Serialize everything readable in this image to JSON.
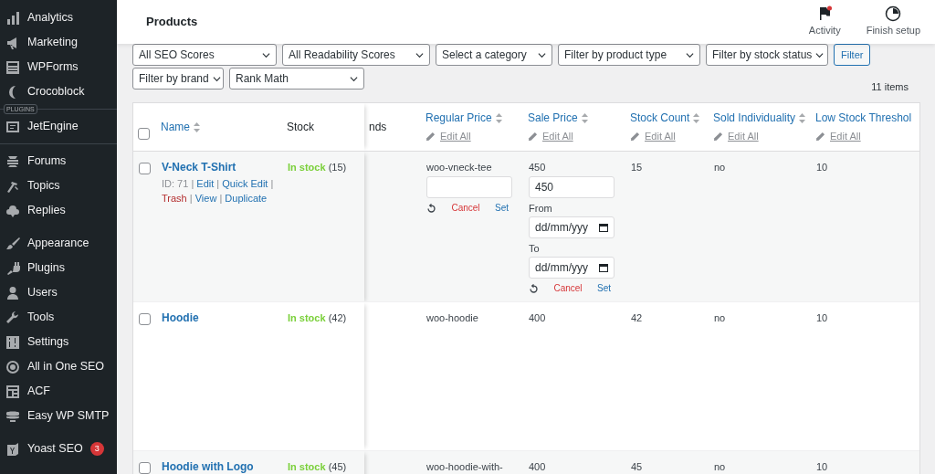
{
  "sidebar": {
    "groups": [
      {
        "items": [
          {
            "label": "Analytics"
          },
          {
            "label": "Marketing"
          },
          {
            "label": "WPForms"
          },
          {
            "label": "Crocoblock"
          }
        ]
      },
      {
        "tag": "PLUGINS",
        "items": [
          {
            "label": "JetEngine"
          }
        ]
      },
      {
        "items": [
          {
            "label": "Forums"
          },
          {
            "label": "Topics"
          },
          {
            "label": "Replies"
          }
        ]
      },
      {
        "items": [
          {
            "label": "Appearance"
          },
          {
            "label": "Plugins"
          },
          {
            "label": "Users"
          },
          {
            "label": "Tools"
          },
          {
            "label": "Settings"
          },
          {
            "label": "All in One SEO"
          },
          {
            "label": "ACF"
          },
          {
            "label": "Easy WP SMTP"
          }
        ]
      },
      {
        "items": [
          {
            "label": "Yoast SEO",
            "badge": "3"
          }
        ]
      }
    ]
  },
  "header": {
    "title": "Products",
    "actions": [
      {
        "label": "Activity",
        "alert": true
      },
      {
        "label": "Finish setup",
        "alert": false
      }
    ]
  },
  "filters": [
    {
      "label": "All SEO Scores"
    },
    {
      "label": "All Readability Scores"
    },
    {
      "label": "Select a category"
    },
    {
      "label": "Filter by product type"
    },
    {
      "label": "Filter by stock status"
    },
    {
      "label": "Filter by brand"
    },
    {
      "label": "Rank Math"
    }
  ],
  "filter_button": "Filter",
  "item_count": "11 items",
  "table": {
    "header_checked": false,
    "columns": [
      {
        "label": "Name",
        "sortable": true
      },
      {
        "label": "Stock",
        "sortable": false
      },
      {
        "label": "nds",
        "sortable": false
      },
      {
        "label": "Regular Price",
        "sortable": true,
        "action": "Edit All"
      },
      {
        "label": "Sale Price",
        "sortable": true,
        "action": "Edit All"
      },
      {
        "label": "Stock Count",
        "sortable": true,
        "action": "Edit All"
      },
      {
        "label": "Sold Individuality",
        "sortable": true,
        "action": "Edit All"
      },
      {
        "label": "Low Stock Threshol",
        "sortable": false,
        "action": "Edit All"
      }
    ],
    "rows": [
      {
        "checked": false,
        "name": "V-Neck T-Shirt",
        "actions_separator": "|",
        "actions": [
          {
            "label": "ID: 71",
            "kind": "id"
          },
          {
            "label": "Edit",
            "kind": "link"
          },
          {
            "label": "Quick Edit",
            "kind": "link"
          },
          {
            "label": "Trash",
            "kind": "danger"
          },
          {
            "label": "View",
            "kind": "link"
          },
          {
            "label": "Duplicate",
            "kind": "link"
          }
        ],
        "stock_status": "In stock",
        "stock_qty": "(15)",
        "regular_price": "woo-vneck-tee",
        "regular_price_editor": {
          "cancel": "Cancel",
          "set": "Set"
        },
        "sale_price": "450",
        "sale_price_editor": {
          "value": "450",
          "from_label": "From",
          "from_value": "dd/mm/yyy",
          "to_label": "To",
          "to_value": "dd/mm/yyy",
          "cancel": "Cancel",
          "set": "Set"
        },
        "stock_count": "15",
        "sold_individually": "no",
        "low_stock_threshold": "10"
      },
      {
        "checked": false,
        "name": "Hoodie",
        "stock_status": "In stock",
        "stock_qty": "(42)",
        "regular_price": "woo-hoodie",
        "sale_price": "400",
        "stock_count": "42",
        "sold_individually": "no",
        "low_stock_threshold": "10"
      },
      {
        "checked": false,
        "name": "Hoodie with Logo",
        "stock_status": "In stock",
        "stock_qty": "(45)",
        "regular_price": "woo-hoodie-with-",
        "sale_price": "400",
        "stock_count": "45",
        "sold_individually": "no",
        "low_stock_threshold": "10"
      }
    ]
  }
}
